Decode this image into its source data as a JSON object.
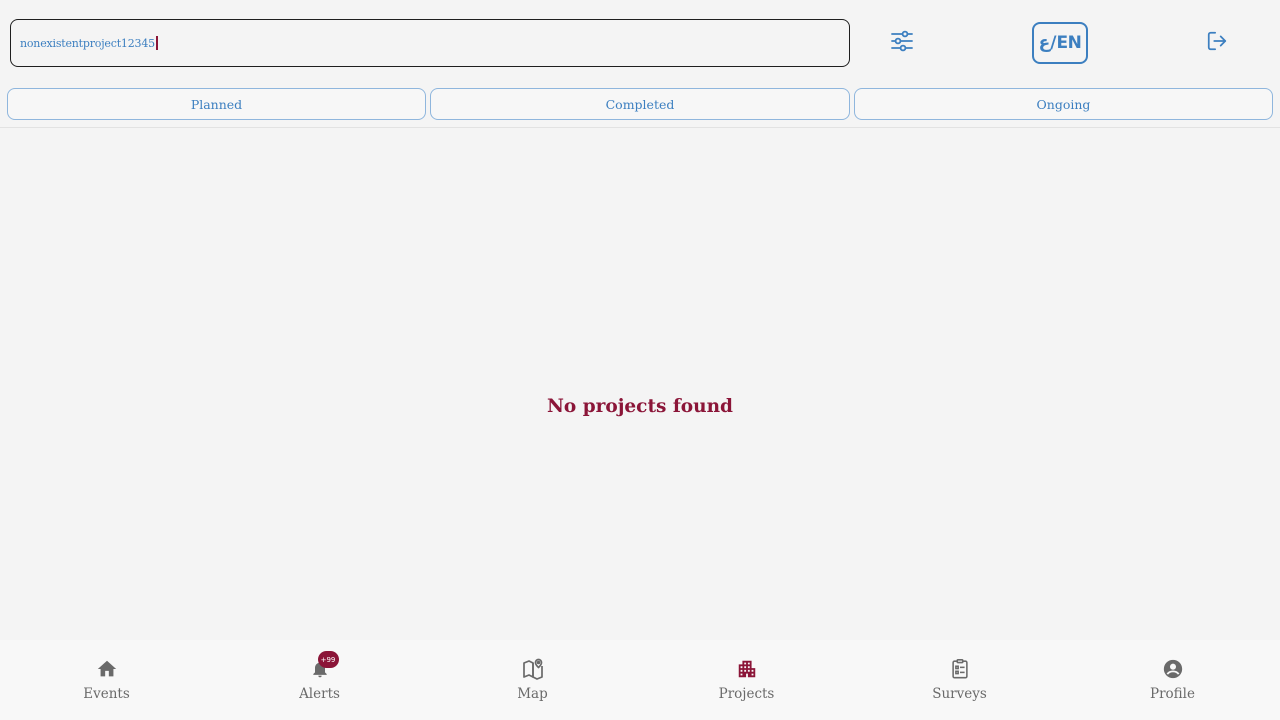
{
  "search": {
    "value": "nonexistentproject12345"
  },
  "header": {
    "language_label": "ع/EN"
  },
  "tabs": [
    {
      "label": "Planned"
    },
    {
      "label": "Completed"
    },
    {
      "label": "Ongoing"
    }
  ],
  "main": {
    "empty_message": "No projects found"
  },
  "nav": {
    "items": [
      {
        "label": "Events",
        "icon": "home-icon"
      },
      {
        "label": "Alerts",
        "icon": "bell-icon",
        "badge": "+99"
      },
      {
        "label": "Map",
        "icon": "map-icon"
      },
      {
        "label": "Projects",
        "icon": "building-icon",
        "active": true
      },
      {
        "label": "Surveys",
        "icon": "clipboard-icon"
      },
      {
        "label": "Profile",
        "icon": "account-circle-icon"
      }
    ]
  },
  "colors": {
    "accent_blue": "#3c7fc0",
    "brand_maroon": "#8b1538",
    "nav_gray": "#6a6a6a",
    "background": "#f4f4f4"
  }
}
